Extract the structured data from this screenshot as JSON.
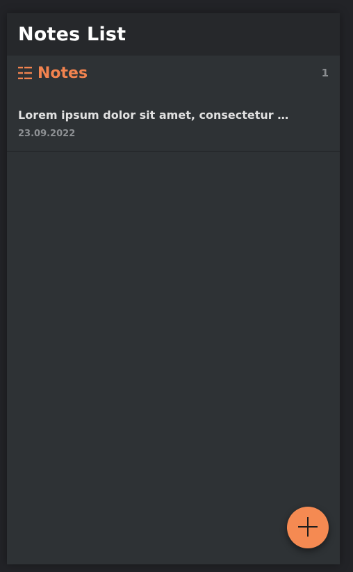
{
  "app": {
    "title": "Notes List"
  },
  "notes_section": {
    "title": "Notes",
    "count": "1",
    "icon": "list-icon"
  },
  "notes": [
    {
      "title": "Lorem ipsum dolor sit amet, consectetur adipi...",
      "date": "23.09.2022"
    }
  ],
  "fab": {
    "icon": "plus-icon"
  },
  "colors": {
    "background": "#222327",
    "panel": "#2e3235",
    "header": "#26282b",
    "accent": "#f2834f",
    "fab": "#f58a52"
  }
}
